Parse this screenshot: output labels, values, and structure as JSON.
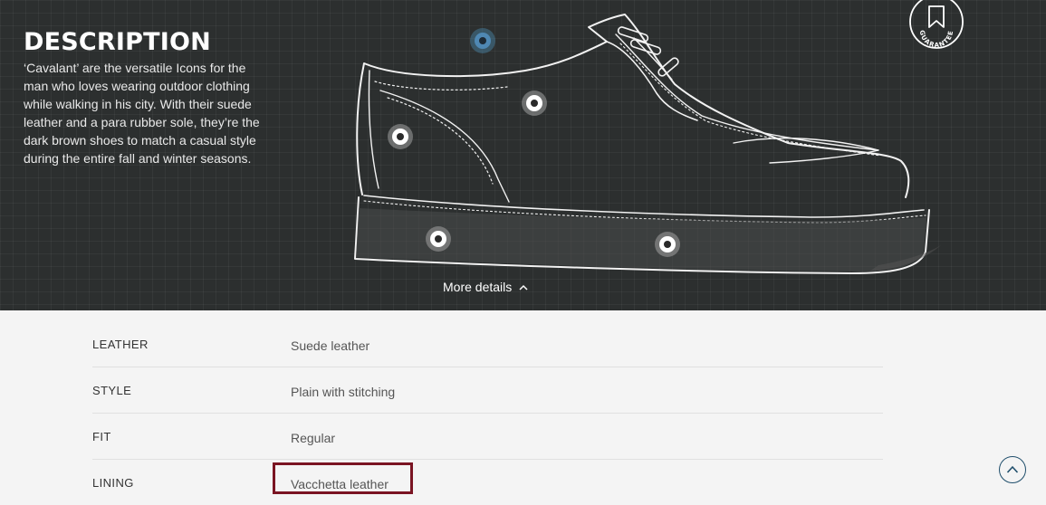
{
  "description": {
    "title": "DESCRIPTION",
    "text": "‘Cavalant’ are the versatile Icons for the man who loves wearing outdoor clothing while walking in his city. With their suede leather and a para rubber sole, they’re the dark brown shoes to match a casual style during the entire fall and winter seasons."
  },
  "badge": {
    "text": "GUARANTEE",
    "icon": "bookmark-icon"
  },
  "more_details": {
    "label": "More details",
    "icon": "chevron-up-icon"
  },
  "hotspots": [
    {
      "name": "hotspot-collar",
      "state": "active"
    },
    {
      "name": "hotspot-vamp",
      "state": "default"
    },
    {
      "name": "hotspot-heel-counter",
      "state": "default"
    },
    {
      "name": "hotspot-sole-heel",
      "state": "default"
    },
    {
      "name": "hotspot-sole-toe",
      "state": "default"
    }
  ],
  "details": [
    {
      "label": "LEATHER",
      "value": "Suede leather"
    },
    {
      "label": "STYLE",
      "value": "Plain with stitching"
    },
    {
      "label": "FIT",
      "value": "Regular"
    },
    {
      "label": "LINING",
      "value": "Vacchetta leather"
    }
  ],
  "colors": {
    "hero_bg": "#2c2f2f",
    "highlight": "#7a1422",
    "accent": "#1f4e6b",
    "active_hotspot": "#4f88b3"
  },
  "scroll_top": {
    "icon": "chevron-up-icon"
  }
}
